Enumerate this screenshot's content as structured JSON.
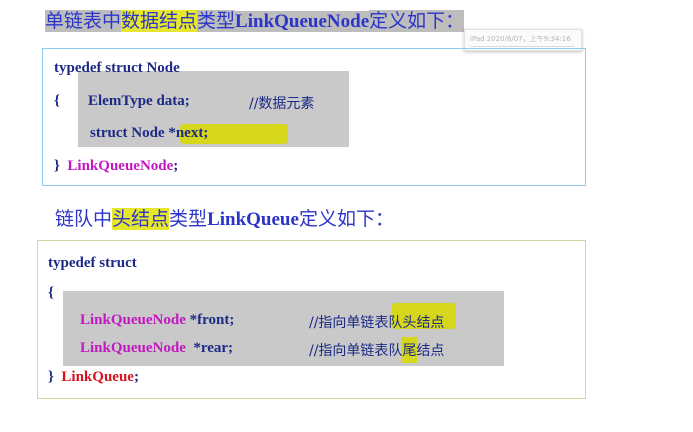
{
  "heading1": {
    "p1": "单链表中",
    "p2": "数据结点",
    "p3": "类型",
    "p4": "LinkQueueNode",
    "p5": "定义如下："
  },
  "stamp": {
    "text": "iPad  2020/6/07，上午9:34:16"
  },
  "node_struct": {
    "line1": "typedef struct Node",
    "brace_open": "{",
    "field1_type": "ElemType data;",
    "field1_comment": "//数据元素",
    "field2_a": "struct Node ",
    "field2_b": "*next;",
    "brace_close": "}",
    "type_name": "LinkQueueNode",
    "semicolon": ";"
  },
  "heading2": {
    "p1": "链队",
    "p2": "中",
    "p3": "头结点",
    "p4": "类型",
    "p5": "LinkQueue",
    "p6": "定义如下："
  },
  "queue_struct": {
    "line1": "typedef struct",
    "brace_open": "{",
    "front_type": "LinkQueueNode",
    "front_ptr": " *front;",
    "front_comment_a": "//指向单链",
    "front_comment_b": "表队头",
    "front_comment_c": "结点",
    "rear_type": "LinkQueueNode",
    "rear_ptr": "  *rear;",
    "rear_comment_a": "//指向单链表",
    "rear_comment_b": "队",
    "rear_comment_c": "尾结点",
    "brace_close": "}",
    "type_name": "LinkQueue",
    "semicolon": ";"
  }
}
